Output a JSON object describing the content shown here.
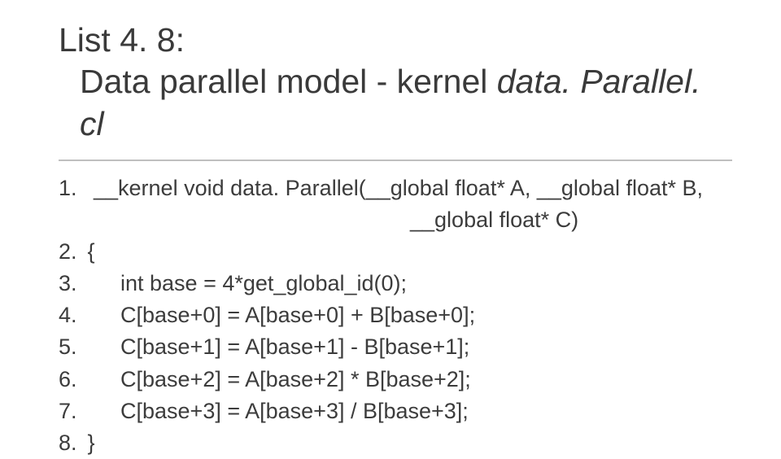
{
  "title": {
    "prefix": "List 4. 8:",
    "line2a": "Data parallel model - kernel ",
    "line2b": "data. Parallel. cl"
  },
  "code": {
    "l1_num": "1.",
    "l1_text": "  __kernel void data. Parallel(__global float* A, __global float* B,",
    "l1b_text": "__global float* C)",
    "l2_num": "2.",
    "l2_text": " {",
    "l3_num": "3.",
    "l3_text": "int base = 4*get_global_id(0);",
    "l4_num": "4.",
    "l4_text": "C[base+0] = A[base+0] + B[base+0];",
    "l5_num": "5.",
    "l5_text": "C[base+1] = A[base+1] - B[base+1];",
    "l6_num": "6.",
    "l6_text": "C[base+2] = A[base+2] * B[base+2];",
    "l7_num": "7.",
    "l7_text": "C[base+3] = A[base+3] / B[base+3];",
    "l8_num": "8.",
    "l8_text": " }"
  }
}
